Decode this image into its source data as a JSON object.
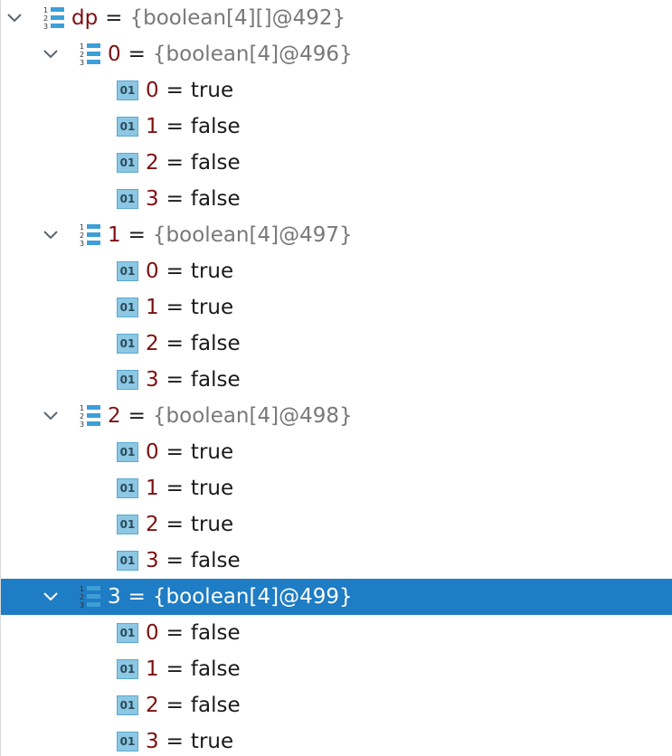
{
  "colors": {
    "selected_background": "#1e7dc4",
    "name_color": "#7d1010",
    "object_value_color": "#787878",
    "icon_fill": "#8cc7e3"
  },
  "root": {
    "name": "dp",
    "eq": "=",
    "value": "{boolean[4][]@492}",
    "icon": "array-icon",
    "expanded": true
  },
  "groups": [
    {
      "name": "0",
      "eq": "=",
      "value": "{boolean[4]@496}",
      "icon": "array-icon",
      "expanded": true,
      "selected": false,
      "items": [
        {
          "index": "0",
          "eq": "=",
          "value": "true",
          "icon_text": "01"
        },
        {
          "index": "1",
          "eq": "=",
          "value": "false",
          "icon_text": "01"
        },
        {
          "index": "2",
          "eq": "=",
          "value": "false",
          "icon_text": "01"
        },
        {
          "index": "3",
          "eq": "=",
          "value": "false",
          "icon_text": "01"
        }
      ]
    },
    {
      "name": "1",
      "eq": "=",
      "value": "{boolean[4]@497}",
      "icon": "array-icon",
      "expanded": true,
      "selected": false,
      "items": [
        {
          "index": "0",
          "eq": "=",
          "value": "true",
          "icon_text": "01"
        },
        {
          "index": "1",
          "eq": "=",
          "value": "true",
          "icon_text": "01"
        },
        {
          "index": "2",
          "eq": "=",
          "value": "false",
          "icon_text": "01"
        },
        {
          "index": "3",
          "eq": "=",
          "value": "false",
          "icon_text": "01"
        }
      ]
    },
    {
      "name": "2",
      "eq": "=",
      "value": "{boolean[4]@498}",
      "icon": "array-icon",
      "expanded": true,
      "selected": false,
      "items": [
        {
          "index": "0",
          "eq": "=",
          "value": "true",
          "icon_text": "01"
        },
        {
          "index": "1",
          "eq": "=",
          "value": "true",
          "icon_text": "01"
        },
        {
          "index": "2",
          "eq": "=",
          "value": "true",
          "icon_text": "01"
        },
        {
          "index": "3",
          "eq": "=",
          "value": "false",
          "icon_text": "01"
        }
      ]
    },
    {
      "name": "3",
      "eq": "=",
      "value": "{boolean[4]@499}",
      "icon": "array-icon",
      "expanded": true,
      "selected": true,
      "items": [
        {
          "index": "0",
          "eq": "=",
          "value": "false",
          "icon_text": "01"
        },
        {
          "index": "1",
          "eq": "=",
          "value": "false",
          "icon_text": "01"
        },
        {
          "index": "2",
          "eq": "=",
          "value": "false",
          "icon_text": "01"
        },
        {
          "index": "3",
          "eq": "=",
          "value": "true",
          "icon_text": "01"
        }
      ]
    }
  ]
}
